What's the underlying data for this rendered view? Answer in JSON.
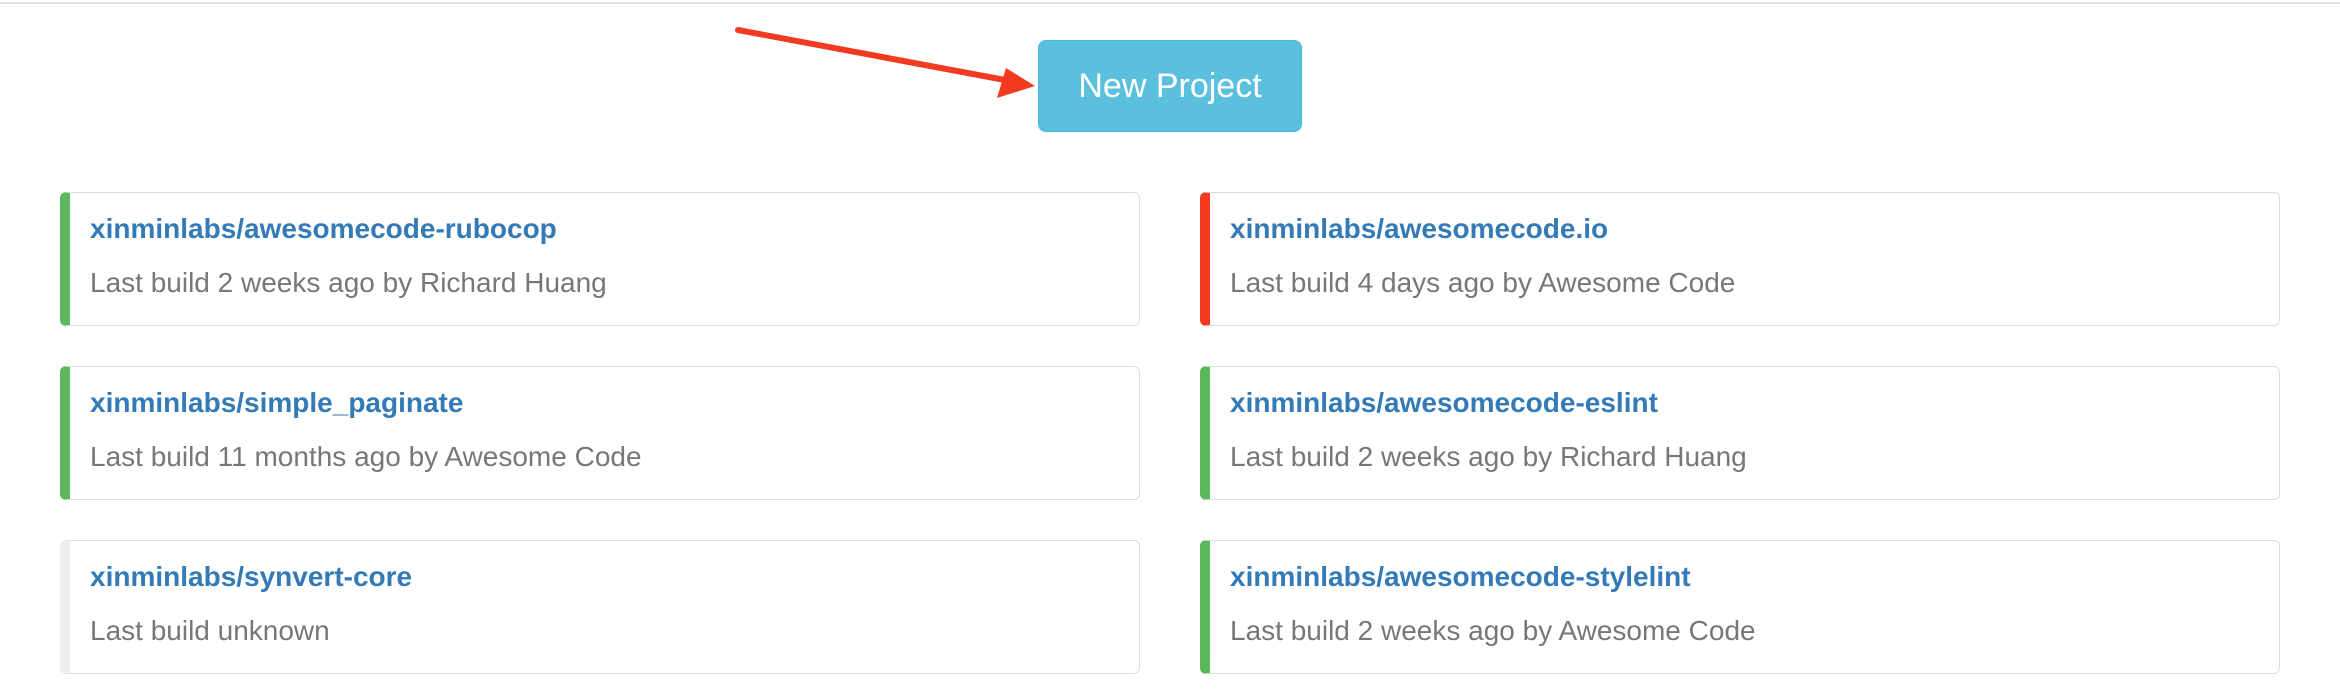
{
  "header": {
    "new_project_label": "New Project"
  },
  "colors": {
    "passed": "#5cb85c",
    "failed": "#f23a20",
    "unknown": "#eeeeee",
    "button": "#5bc0de",
    "link": "#337ab7",
    "arrow": "#f23a20"
  },
  "projects": [
    {
      "name": "xinminlabs/awesomecode-rubocop",
      "last_build": "Last build 2 weeks ago by Richard Huang",
      "status": "passed"
    },
    {
      "name": "xinminlabs/awesomecode.io",
      "last_build": "Last build 4 days ago by Awesome Code",
      "status": "failed"
    },
    {
      "name": "xinminlabs/simple_paginate",
      "last_build": "Last build 11 months ago by Awesome Code",
      "status": "passed"
    },
    {
      "name": "xinminlabs/awesomecode-eslint",
      "last_build": "Last build 2 weeks ago by Richard Huang",
      "status": "passed"
    },
    {
      "name": "xinminlabs/synvert-core",
      "last_build": "Last build unknown",
      "status": "unknown"
    },
    {
      "name": "xinminlabs/awesomecode-stylelint",
      "last_build": "Last build 2 weeks ago by Awesome Code",
      "status": "passed"
    }
  ]
}
